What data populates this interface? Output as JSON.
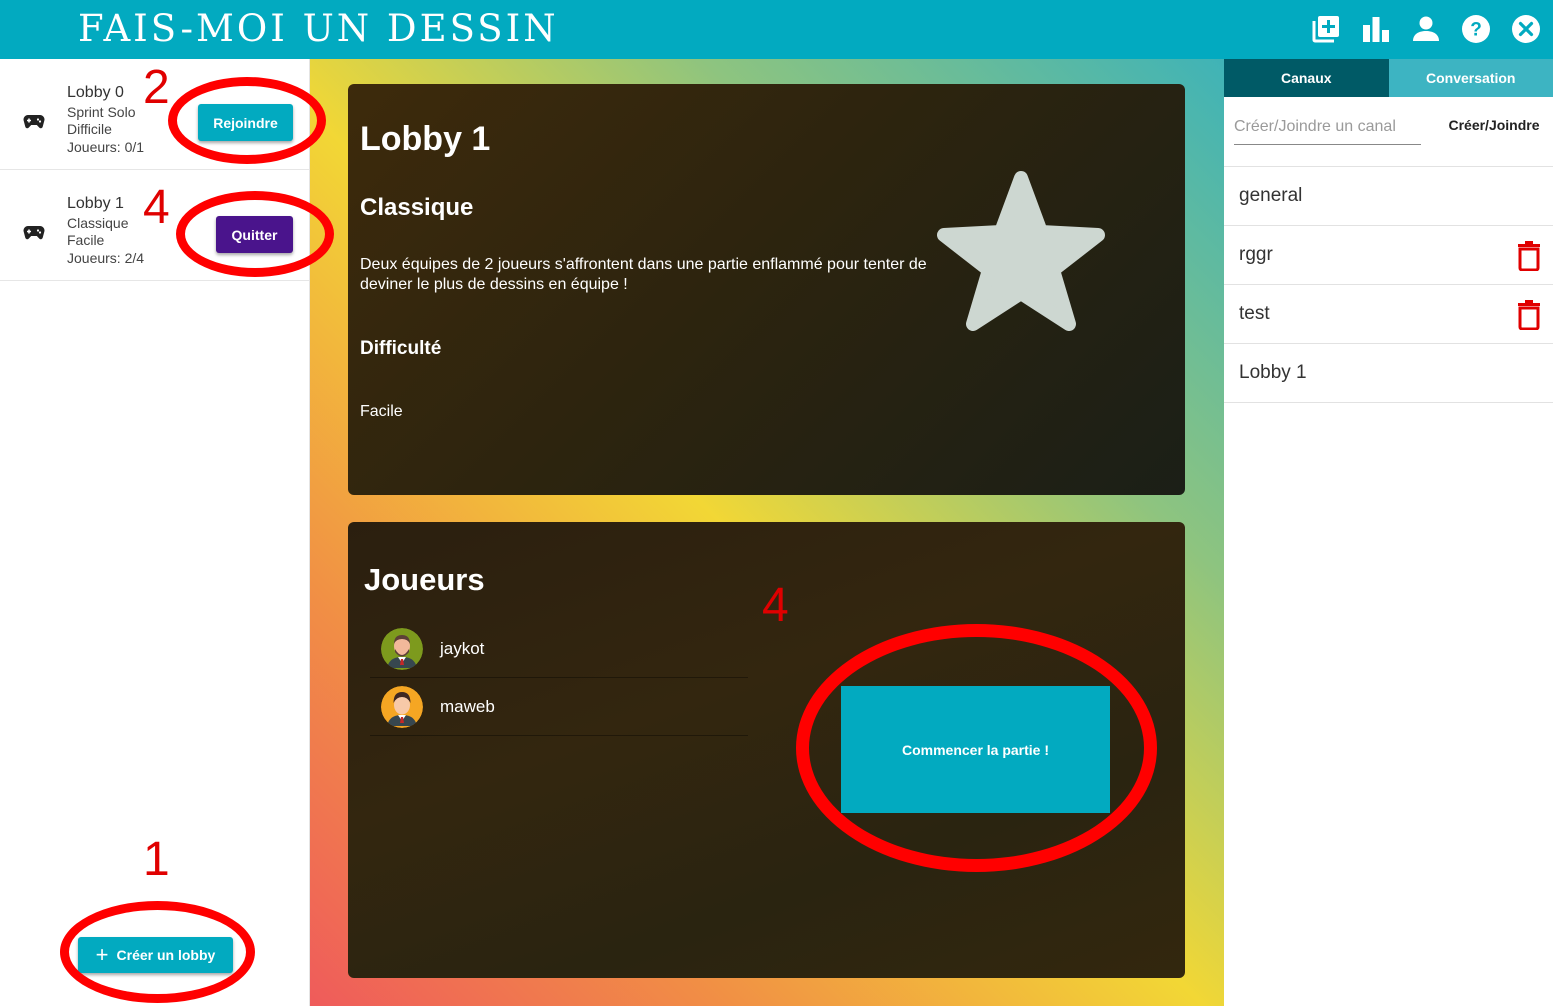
{
  "header": {
    "title": "FAIS-MOI UN DESSIN",
    "icons": [
      "add-box-icon",
      "bar-chart-icon",
      "person-icon",
      "help-icon",
      "close-icon"
    ]
  },
  "lobbies": [
    {
      "name": "Lobby 0",
      "mode": "Sprint Solo",
      "difficulty": "Difficile",
      "players": "Joueurs: 0/1",
      "action_label": "Rejoindre"
    },
    {
      "name": "Lobby 1",
      "mode": "Classique",
      "difficulty": "Facile",
      "players": "Joueurs: 2/4",
      "action_label": "Quitter"
    }
  ],
  "create_lobby_label": "Créer un lobby",
  "lobby_detail": {
    "title": "Lobby 1",
    "mode": "Classique",
    "description": "Deux équipes de 2 joueurs s'affrontent dans une partie enflammé pour tenter de deviner le plus de dessins en équipe !",
    "difficulty_heading": "Difficulté",
    "difficulty_value": "Facile"
  },
  "players_panel": {
    "title": "Joueurs",
    "players": [
      {
        "name": "jaykot"
      },
      {
        "name": "maweb"
      }
    ],
    "start_label": "Commencer la partie !"
  },
  "chat": {
    "tabs": [
      {
        "label": "Canaux",
        "active": true
      },
      {
        "label": "Conversation",
        "active": false
      }
    ],
    "channel_input_placeholder": "Créer/Joindre un canal",
    "channel_button_label": "Créer/Joindre",
    "channels": [
      {
        "name": "general",
        "deletable": false
      },
      {
        "name": "rggr",
        "deletable": true
      },
      {
        "name": "test",
        "deletable": true
      },
      {
        "name": "Lobby 1",
        "deletable": false
      }
    ]
  },
  "annotations": {
    "labels": [
      "2",
      "4",
      "1",
      "4"
    ]
  },
  "colors": {
    "primary": "#02aac0",
    "quit_button": "#4a148c",
    "tab_active": "#005a66",
    "annotation": "#ff0000",
    "trash": "#e00000"
  }
}
